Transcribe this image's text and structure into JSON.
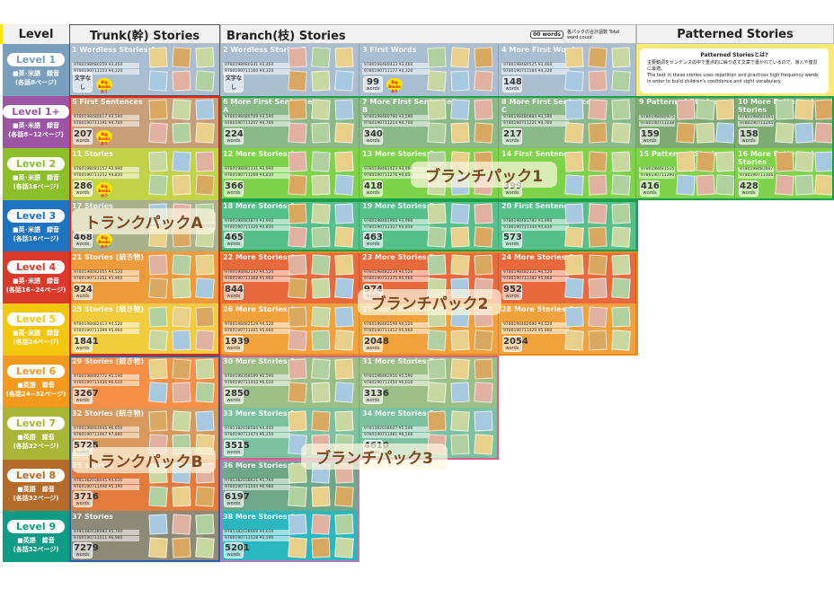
{
  "headers": {
    "level": "Level",
    "trunk": "Trunk(幹) Stories",
    "branch": "Branch(枝) Stories",
    "patterned": "Patterned Stories",
    "legend_box": "00 words",
    "legend_text": "各パックの合計語数 Total word count"
  },
  "levels": [
    {
      "label": "Level 1",
      "line1": "■英･米語　録音",
      "line2": "(各話8ページ)",
      "color": "#7a9fbd"
    },
    {
      "label": "Level 1+",
      "line1": "■英･米語　録音",
      "line2": "(各話8~12ページ)",
      "color": "#9c55a4"
    },
    {
      "label": "Level 2",
      "line1": "■英･米語　録音",
      "line2": "(各話16ページ)",
      "color": "#8dbf2a"
    },
    {
      "label": "Level 3",
      "line1": "■英･米語　録音",
      "line2": "(各話16ページ)",
      "color": "#1e73be"
    },
    {
      "label": "Level 4",
      "line1": "■英･米語　録音",
      "line2": "(各話16~24ページ)",
      "color": "#d93a2c"
    },
    {
      "label": "Level 5",
      "line1": "■英･米語　録音",
      "line2": "(各話24ページ)",
      "color": "#f2c70e"
    },
    {
      "label": "Level 6",
      "line1": "■英語　録音",
      "line2": "(各話24~32ページ)",
      "color": "#f39a1e"
    },
    {
      "label": "Level 7",
      "line1": "■英語　録音",
      "line2": "(各話32ページ)",
      "color": "#a9b534"
    },
    {
      "label": "Level 8",
      "line1": "■英語　録音",
      "line2": "(各話32ページ)",
      "color": "#b46a28"
    },
    {
      "label": "Level 9",
      "line1": "■英語　録音",
      "line2": "(各話32ページ)",
      "color": "#0f9b84"
    }
  ],
  "cells": [
    {
      "num": "1",
      "title": "Wordless Stories A",
      "isbn1": "9780198480259 ¥3,460",
      "isbn2": "9780190711153 ¥4,320",
      "words": "文字なし",
      "unit": "",
      "big": true
    },
    {
      "num": "5",
      "title": "First Sentences",
      "isbn1": "9780198480617 ¥3,590",
      "isbn2": "9780190711191 ¥4,700",
      "words": "207",
      "unit": "words",
      "big": true
    },
    {
      "num": "11",
      "title": "Stories",
      "isbn1": "9780198481157 ¥3,990",
      "isbn2": "9780190711252 ¥4,830",
      "words": "286",
      "unit": "words",
      "big": true
    },
    {
      "num": "17",
      "title": "Stories",
      "isbn1": "",
      "isbn2": "",
      "words": "468",
      "unit": "words",
      "big": true
    },
    {
      "num": "21",
      "title": "Stories (続き物)",
      "isbn1": "9780198482055 ¥4,520",
      "isbn2": "9780190711351 ¥5,960",
      "words": "924",
      "unit": "words",
      "big": false
    },
    {
      "num": "25",
      "title": "Stories (続き物)",
      "isbn1": "9780198482413 ¥4,520",
      "isbn2": "9780190711399 ¥5,960",
      "words": "1841",
      "unit": "words",
      "big": false
    },
    {
      "num": "29",
      "title": "Stories (続き物)",
      "isbn1": "9780198482772 ¥5,590",
      "isbn2": "9780190711436 ¥6,610",
      "words": "3267",
      "unit": "words",
      "big": false
    },
    {
      "num": "32",
      "title": "Stories (続き物)",
      "isbn1": "9780198483045 ¥6,650",
      "isbn2": "9780190711467 ¥7,880",
      "words": "5725",
      "unit": "words",
      "big": false
    },
    {
      "num": "35",
      "title": "Stories",
      "isbn1": "9781382038045 ¥4,610",
      "isbn2": "9780190711498 ¥5,390",
      "words": "3716",
      "unit": "words",
      "big": false
    },
    {
      "num": "37",
      "title": "Stories",
      "isbn1": "9781382038083 ¥5,760",
      "isbn2": "9780190711511 ¥6,980",
      "words": "7279",
      "unit": "words",
      "big": false
    },
    {
      "num": "2",
      "title": "Wordless Stories B",
      "isbn1": "9780198480341 ¥3,460",
      "isbn2": "9780190711160 ¥4,320",
      "words": "文字なし",
      "unit": "",
      "big": false
    },
    {
      "num": "3",
      "title": "First Words",
      "isbn1": "9780198480433 ¥3,460",
      "isbn2": "9780190711177 ¥4,320",
      "words": "99",
      "unit": "words",
      "big": true
    },
    {
      "num": "4",
      "title": "More First Words",
      "isbn1": "9780198480525 ¥3,460",
      "isbn2": "9780190711184 ¥4,320",
      "words": "148",
      "unit": "words",
      "big": false
    },
    {
      "num": "6",
      "title": "More First Sentences A",
      "isbn1": "9780198480709 ¥3,590",
      "isbn2": "9780190711207 ¥4,700",
      "words": "224",
      "unit": "words",
      "big": false
    },
    {
      "num": "7",
      "title": "More First Sentences B",
      "isbn1": "9780198480790 ¥3,590",
      "isbn2": "9780190711214 ¥4,700",
      "words": "340",
      "unit": "words",
      "big": false
    },
    {
      "num": "8",
      "title": "More First Sentences C",
      "isbn1": "9780198480884 ¥3,590",
      "isbn2": "9780190711221 ¥4,700",
      "words": "217",
      "unit": "words",
      "big": false
    },
    {
      "num": "12",
      "title": "More Stories A",
      "isbn1": "9780198481331 ¥3,990",
      "isbn2": "9780190711269 ¥4,830",
      "words": "366",
      "unit": "words",
      "big": false
    },
    {
      "num": "13",
      "title": "More Stories B",
      "isbn1": "9780198481423 ¥3,990",
      "isbn2": "9780190711276 ¥4,830",
      "words": "418",
      "unit": "words",
      "big": false
    },
    {
      "num": "14",
      "title": "First Sentences",
      "isbn1": "",
      "isbn2": "",
      "words": "399",
      "unit": "words",
      "big": false
    },
    {
      "num": "18",
      "title": "More Stories A",
      "isbn1": "9780198481874 ¥3,990",
      "isbn2": "9780190711320 ¥4,830",
      "words": "465",
      "unit": "words",
      "big": false
    },
    {
      "num": "19",
      "title": "More Stories B",
      "isbn1": "9780198481966 ¥3,990",
      "isbn2": "9780190711337 ¥4,830",
      "words": "463",
      "unit": "words",
      "big": false
    },
    {
      "num": "20",
      "title": "First Sentences",
      "isbn1": "9780198481782 ¥3,990",
      "isbn2": "9780190711344 ¥4,830",
      "words": "573",
      "unit": "words",
      "big": false
    },
    {
      "num": "22",
      "title": "More Stories A",
      "isbn1": "9780198482147 ¥4,520",
      "isbn2": "9780190711368 ¥5,960",
      "words": "844",
      "unit": "words",
      "big": false
    },
    {
      "num": "23",
      "title": "More Stories B",
      "isbn1": "9780198482239 ¥4,520",
      "isbn2": "9780190711375 ¥5,960",
      "words": "974",
      "unit": "words",
      "big": false
    },
    {
      "num": "24",
      "title": "More Stories C",
      "isbn1": "9780198482321 ¥4,520",
      "isbn2": "9780190711382 ¥5,960",
      "words": "952",
      "unit": "words",
      "big": false
    },
    {
      "num": "26",
      "title": "More Stories A",
      "isbn1": "9780198482529 ¥4,520",
      "isbn2": "9780190711405 ¥5,960",
      "words": "1939",
      "unit": "words",
      "big": false
    },
    {
      "num": "27",
      "title": "More Stories B",
      "isbn1": "9780198482598 ¥4,520",
      "isbn2": "9780190711412 ¥5,960",
      "words": "2048",
      "unit": "words",
      "big": false
    },
    {
      "num": "28",
      "title": "More Stories C",
      "isbn1": "9780198482680 ¥4,520",
      "isbn2": "9780190711429 ¥5,960",
      "words": "2054",
      "unit": "words",
      "big": false
    },
    {
      "num": "30",
      "title": "More Stories A",
      "isbn1": "9780198358589 ¥5,590",
      "isbn2": "9780190711443 ¥6,610",
      "words": "2850",
      "unit": "words",
      "big": false
    },
    {
      "num": "31",
      "title": "More Stories B",
      "isbn1": "9780198482956 ¥5,590",
      "isbn2": "9780190711450 ¥6,610",
      "words": "3136",
      "unit": "words",
      "big": false
    },
    {
      "num": "33",
      "title": "More Stories A",
      "isbn1": "9781382038584 ¥4,440",
      "isbn2": "9780190711474 ¥5,250",
      "words": "3515",
      "unit": "words",
      "big": false
    },
    {
      "num": "34",
      "title": "More Stories B",
      "isbn1": "9781382038607 ¥5,540",
      "isbn2": "9780190711481 ¥6,560",
      "words": "4610",
      "unit": "words",
      "big": false
    },
    {
      "num": "36",
      "title": "More Stories A",
      "isbn1": "9781382038621 ¥5,760",
      "isbn2": "9780190711504 ¥6,980",
      "words": "6197",
      "unit": "words",
      "big": false
    },
    {
      "num": "38",
      "title": "More Stories A",
      "isbn1": "9781382038669 ¥4,610",
      "isbn2": "9780190711528 ¥5,590",
      "words": "5201",
      "unit": "words",
      "big": false
    },
    {
      "num": "9",
      "title": "Patterned Stories",
      "isbn1": "9780198480975 ¥3,590",
      "isbn2": "9780190711238 ¥4,700",
      "words": "159",
      "unit": "words",
      "big": false
    },
    {
      "num": "10",
      "title": "More Patterned Stories",
      "isbn1": "9780198481065 ¥3,590",
      "isbn2": "9780190711245 ¥4,700",
      "words": "158",
      "unit": "words",
      "big": false
    },
    {
      "num": "15",
      "title": "Patterned Stories",
      "isbn1": "9780198481515 ¥3,990",
      "isbn2": "9780190711290 ¥4,830",
      "words": "416",
      "unit": "words",
      "big": false
    },
    {
      "num": "16",
      "title": "More Patterned Stories",
      "isbn1": "9780198481607 ¥3,990",
      "isbn2": "9780190711306 ¥4,830",
      "words": "428",
      "unit": "words",
      "big": false
    }
  ],
  "big_books": "Big Books あり",
  "tip": {
    "title": "Patterned Storiesとは?",
    "jp": "主要動詞をセンテンスの中で重点的に繰り返す文章で書かれているので、導入や復習に最適。",
    "en": "The text in these stories uses repetition and practices high frequency words in order to build children's confidence and sight vocabulary."
  },
  "packs": {
    "trunkA": "トランクパックA",
    "trunkB": "トランクパックB",
    "branch1": "ブランチパック1",
    "branch2": "ブランチパック2",
    "branch3": "ブランチパック3"
  }
}
